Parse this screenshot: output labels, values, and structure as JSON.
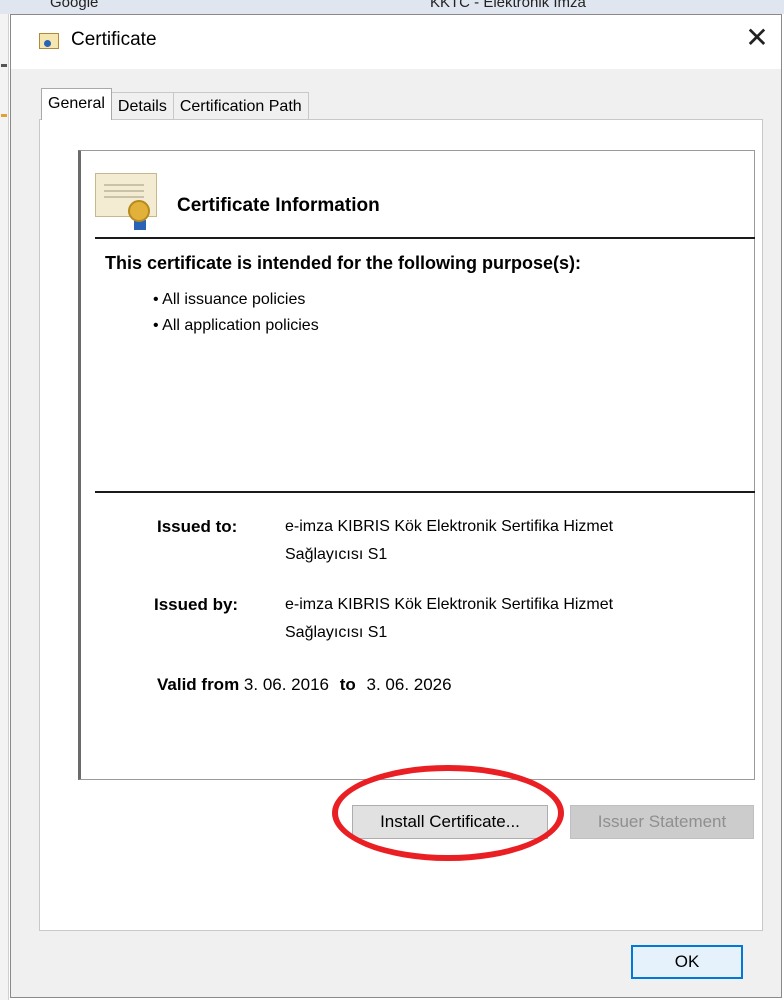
{
  "background": {
    "browser_tab_1": "Google",
    "browser_tab_2": "KKTC - Elektronik İmza"
  },
  "dialog": {
    "title": "Certificate",
    "close_glyph": "✕",
    "title_icon": "certificate-icon"
  },
  "tabs": [
    {
      "label": "General",
      "active": true
    },
    {
      "label": "Details",
      "active": false
    },
    {
      "label": "Certification Path",
      "active": false
    }
  ],
  "general": {
    "section_title": "Certificate Information",
    "purpose_heading": "This certificate is intended for the following purpose(s):",
    "purposes": [
      "All issuance policies",
      "All application policies"
    ],
    "issued_to_label": "Issued to:",
    "issued_to_line1": "e-imza KIBRIS Kök Elektronik Sertifika Hizmet",
    "issued_to_line2": "Sağlayıcısı S1",
    "issued_by_label": "Issued by:",
    "issued_by_line1": "e-imza KIBRIS Kök Elektronik Sertifika Hizmet",
    "issued_by_line2": "Sağlayıcısı S1",
    "valid_from_label": "Valid from",
    "valid_from": "3. 06. 2016",
    "valid_to_label": "to",
    "valid_to": "3. 06. 2026"
  },
  "buttons": {
    "install": "Install Certificate...",
    "issuer_statement": "Issuer Statement",
    "ok": "OK"
  },
  "colors": {
    "highlight_ring": "#ea1f23",
    "primary_border": "#0078d7"
  }
}
